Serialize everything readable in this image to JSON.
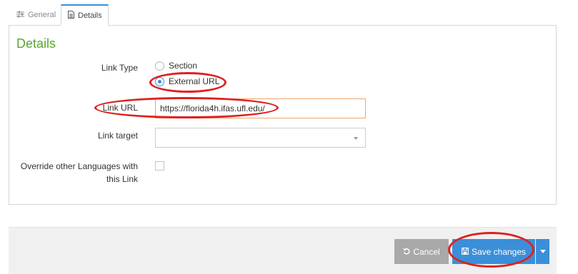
{
  "tabs": [
    {
      "label": "General",
      "icon": "sliders-icon",
      "active": false
    },
    {
      "label": "Details",
      "icon": "document-icon",
      "active": true
    }
  ],
  "panel": {
    "title": "Details",
    "title_color": "#5aa630"
  },
  "form": {
    "link_type": {
      "label": "Link Type",
      "options": [
        "Section",
        "External URL"
      ],
      "selected": "External URL"
    },
    "link_url": {
      "label": "Link URL",
      "value": "https://florida4h.ifas.ufl.edu/"
    },
    "link_target": {
      "label": "Link target",
      "value": ""
    },
    "override": {
      "label_line1": "Override other Languages with",
      "label_line2": "this Link",
      "checked": false
    }
  },
  "footer": {
    "cancel_label": "Cancel",
    "save_label": "Save changes"
  },
  "colors": {
    "accent": "#3a8fd8",
    "cancel_bg": "#a9a9a9",
    "annotation": "#e02020",
    "input_focus_border": "#f0a56b"
  }
}
